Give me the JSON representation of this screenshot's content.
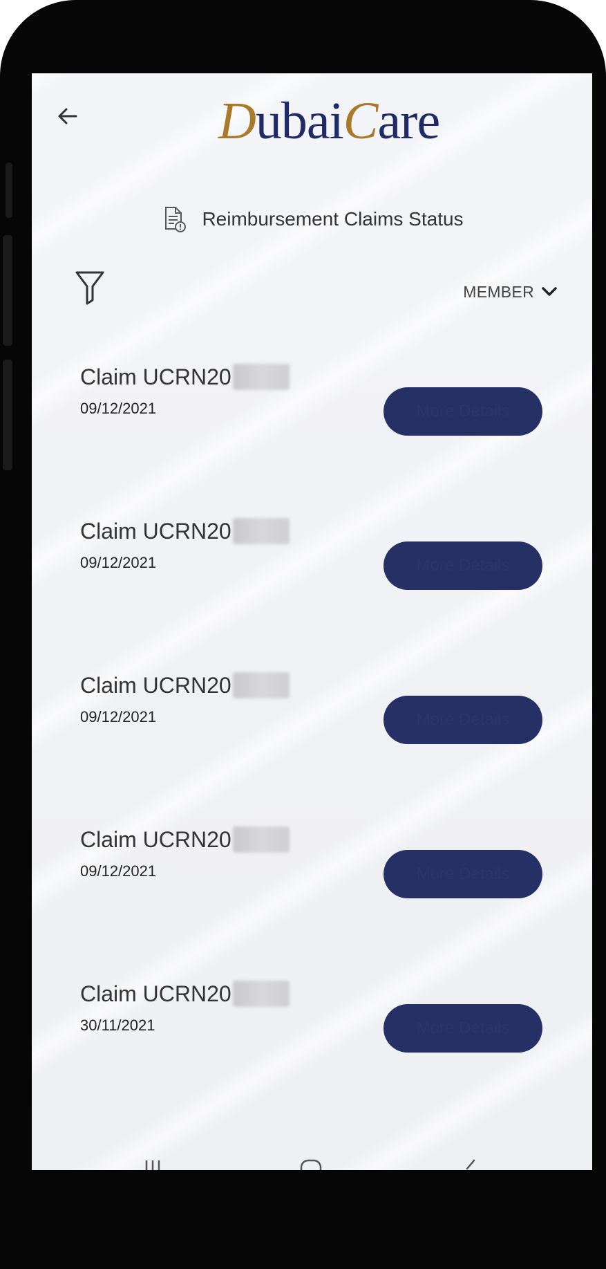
{
  "app": {
    "logo_part1": "D",
    "logo_part2": "ubai",
    "logo_part3": "C",
    "logo_part4": "are"
  },
  "header": {
    "title": "Reimbursement Claims Status"
  },
  "filter": {
    "member_label": "MEMBER"
  },
  "claims": [
    {
      "title": "Claim UCRN20",
      "date": "09/12/2021",
      "button": "More Details"
    },
    {
      "title": "Claim UCRN20",
      "date": "09/12/2021",
      "button": "More Details"
    },
    {
      "title": "Claim UCRN20",
      "date": "09/12/2021",
      "button": "More Details"
    },
    {
      "title": "Claim UCRN20",
      "date": "09/12/2021",
      "button": "More Details"
    },
    {
      "title": "Claim UCRN20",
      "date": "30/11/2021",
      "button": "More Details"
    }
  ],
  "icons": {
    "back": "arrow-left-icon",
    "doc": "document-icon",
    "filter": "funnel-icon",
    "chevron": "chevron-down-icon"
  },
  "colors": {
    "brand_navy": "#1f2a66",
    "brand_gold": "#a97a2a",
    "button_bg": "#253064"
  }
}
